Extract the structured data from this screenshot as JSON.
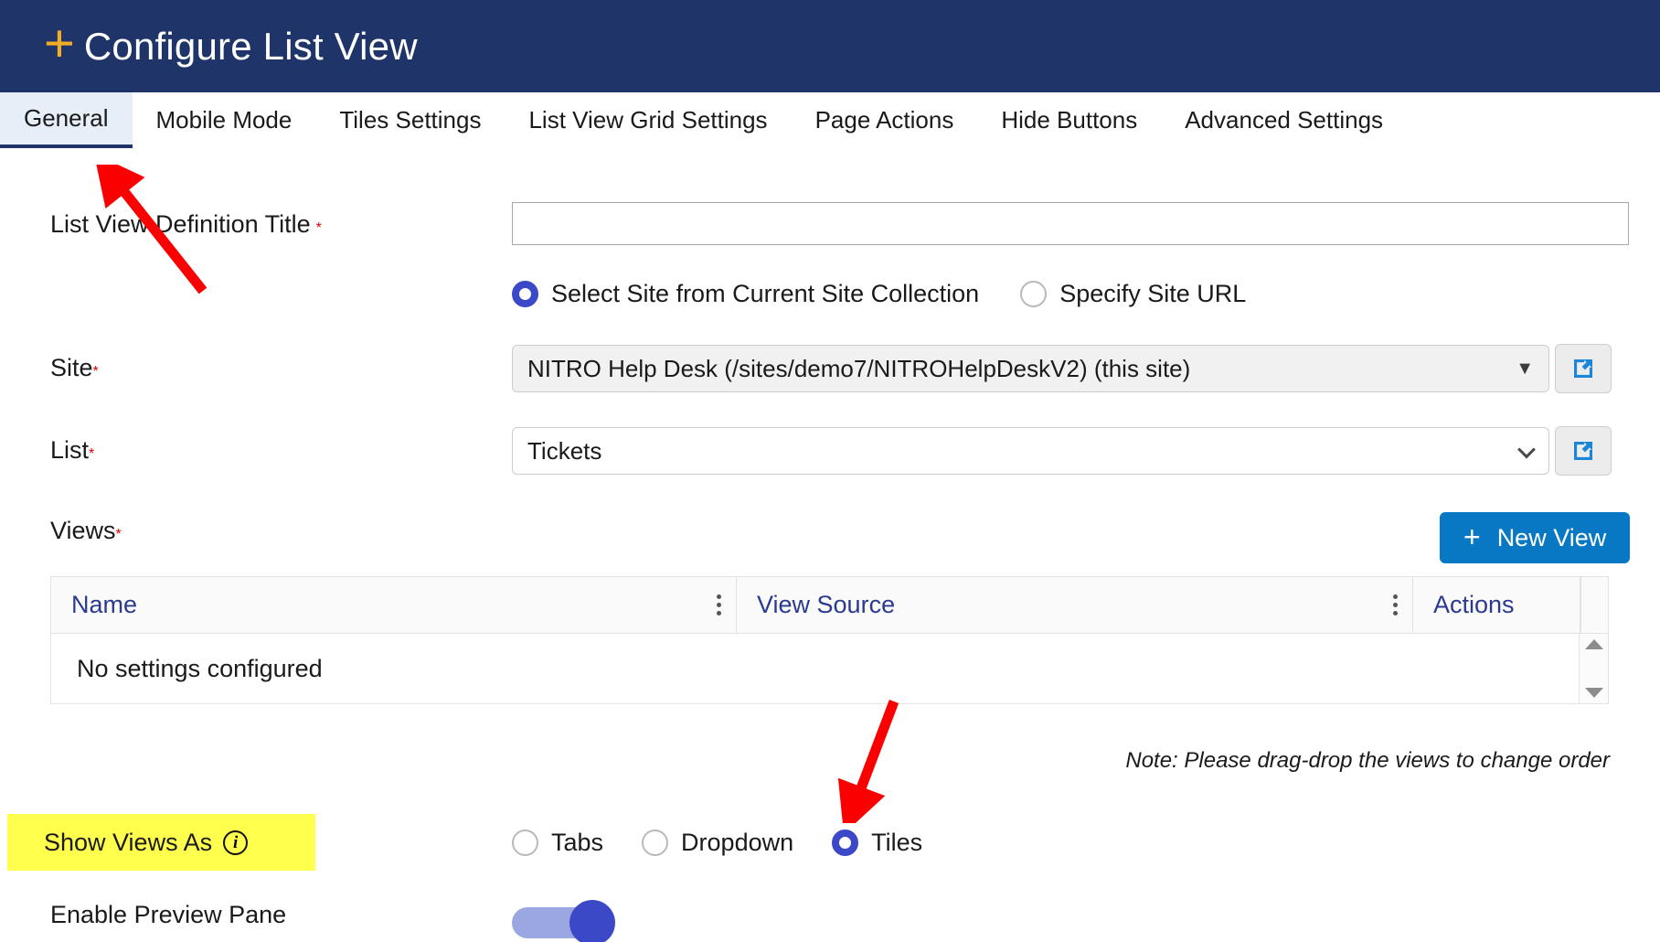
{
  "header": {
    "plus_icon": "plus-icon",
    "title": "Configure List View",
    "bg_color": "#1f3468",
    "plus_color": "#f0ad27"
  },
  "tabs": [
    {
      "label": "General",
      "active": true
    },
    {
      "label": "Mobile Mode",
      "active": false
    },
    {
      "label": "Tiles Settings",
      "active": false
    },
    {
      "label": "List View Grid Settings",
      "active": false
    },
    {
      "label": "Page Actions",
      "active": false
    },
    {
      "label": "Hide Buttons",
      "active": false
    },
    {
      "label": "Advanced Settings",
      "active": false
    }
  ],
  "form": {
    "title_field": {
      "label": "List View Definition Title",
      "required_marker": "*",
      "value": "",
      "placeholder": ""
    },
    "site_source": {
      "options": [
        {
          "label": "Select Site from Current Site Collection",
          "selected": true
        },
        {
          "label": "Specify Site URL",
          "selected": false
        }
      ]
    },
    "site": {
      "label": "Site",
      "required_marker": "*",
      "value": "NITRO Help Desk (/sites/demo7/NITROHelpDeskV2) (this site)",
      "caret_icon": "caret-down-icon",
      "open_icon": "external-link-icon"
    },
    "list": {
      "label": "List",
      "required_marker": "*",
      "value": "Tickets",
      "chevron_icon": "chevron-down-icon",
      "open_icon": "external-link-icon"
    },
    "views": {
      "label": "Views",
      "required_marker": "*",
      "new_view_button": "New View",
      "new_view_plus": "+",
      "columns": [
        {
          "label": "Name",
          "menu_icon": "kebab-menu-icon"
        },
        {
          "label": "View Source",
          "menu_icon": "kebab-menu-icon"
        },
        {
          "label": "Actions",
          "menu_icon": null
        }
      ],
      "empty_message": "No settings configured",
      "scroll_up_icon": "triangle-up-icon",
      "scroll_down_icon": "triangle-down-icon",
      "note": "Note: Please drag-drop the views to change order"
    },
    "show_views_as": {
      "label": "Show Views As",
      "info_icon": "info-icon",
      "info_glyph": "i",
      "highlight_color": "#ffff4d",
      "options": [
        {
          "label": "Tabs",
          "selected": false
        },
        {
          "label": "Dropdown",
          "selected": false
        },
        {
          "label": "Tiles",
          "selected": true
        }
      ]
    },
    "enable_preview_pane": {
      "label": "Enable Preview Pane",
      "state": "on"
    }
  },
  "annotations": {
    "arrow_color": "#fb0000",
    "arrow_to_general_tab": "arrow-pointing-to-general-tab",
    "arrow_to_tiles_radio": "arrow-pointing-to-tiles-radio"
  }
}
